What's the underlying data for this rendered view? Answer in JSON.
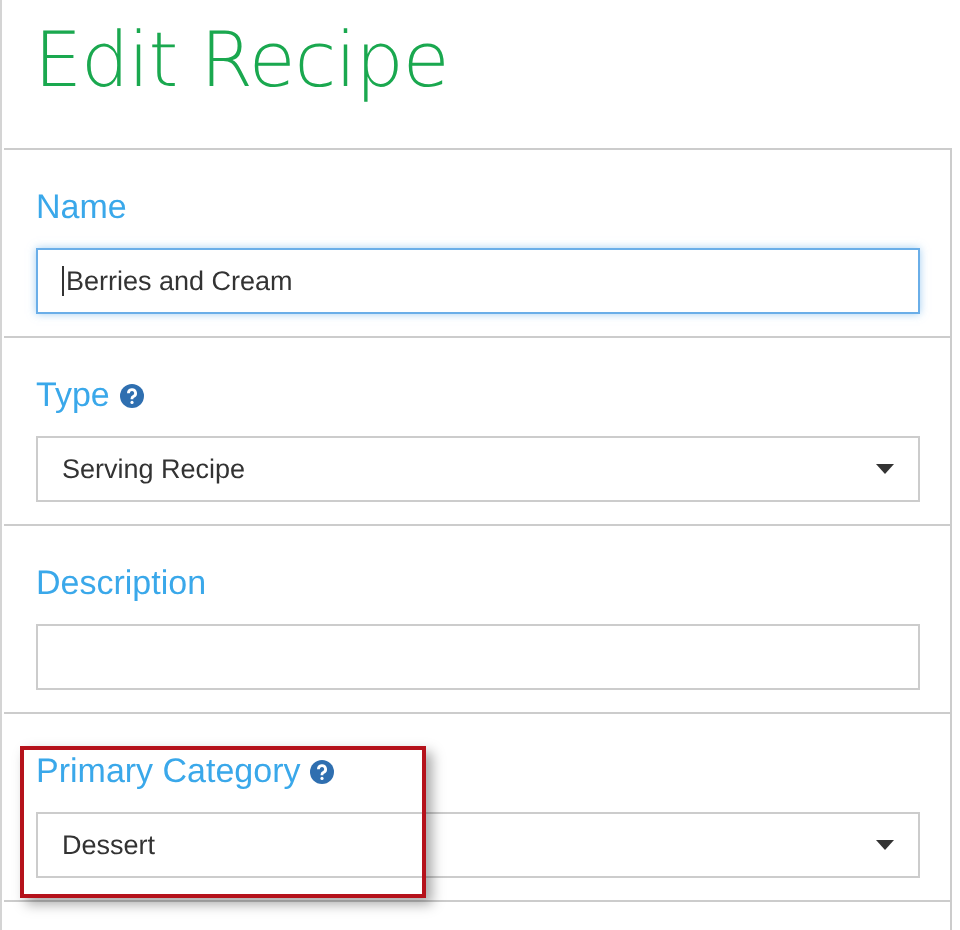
{
  "page": {
    "title": "Edit Recipe"
  },
  "fields": [
    {
      "kind": "text",
      "label": "Name",
      "help": false,
      "value": "Berries and Cream",
      "focused": true,
      "highlighted": false
    },
    {
      "kind": "select",
      "label": "Type",
      "help": true,
      "value": "Serving Recipe",
      "focused": false,
      "highlighted": false
    },
    {
      "kind": "text",
      "label": "Description",
      "help": false,
      "focused": false,
      "highlighted": false
    },
    {
      "kind": "select",
      "label": "Primary Category",
      "help": true,
      "value": "Dessert",
      "focused": false,
      "highlighted": true
    }
  ]
}
